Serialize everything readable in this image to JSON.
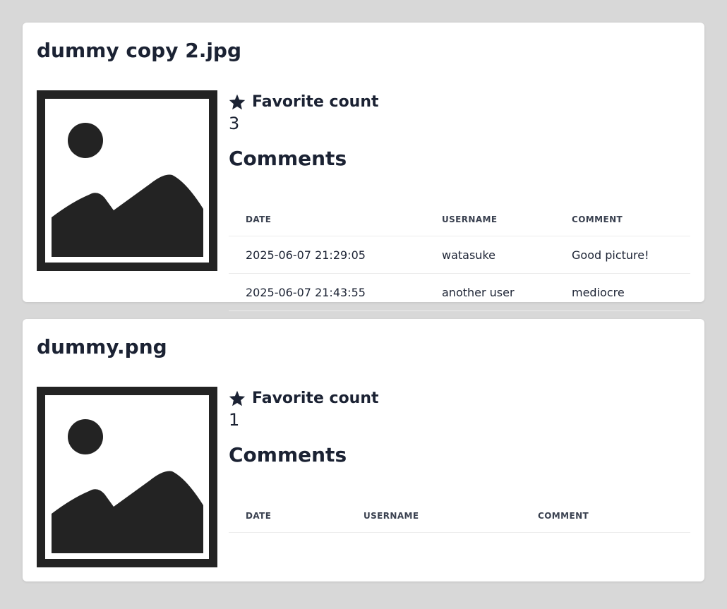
{
  "images": [
    {
      "title": "dummy copy 2.jpg",
      "favorite_label": "Favorite count",
      "favorite_count": "3",
      "comments_heading": "Comments",
      "table": {
        "headers": [
          "DATE",
          "USERNAME",
          "COMMENT"
        ],
        "rows": [
          [
            "2025-06-07 21:29:05",
            "watasuke",
            "Good picture!"
          ],
          [
            "2025-06-07 21:43:55",
            "another user",
            "mediocre"
          ]
        ]
      }
    },
    {
      "title": "dummy.png",
      "favorite_label": "Favorite count",
      "favorite_count": "1",
      "comments_heading": "Comments",
      "table": {
        "headers": [
          "DATE",
          "USERNAME",
          "COMMENT"
        ],
        "rows": []
      }
    }
  ],
  "icons": {
    "favorite": "star-icon",
    "thumbnail": "image-placeholder-icon"
  },
  "colors": {
    "page_background": "#d8d8d8",
    "card_background": "#ffffff",
    "text": "#1b2233",
    "placeholder": "#232323"
  }
}
